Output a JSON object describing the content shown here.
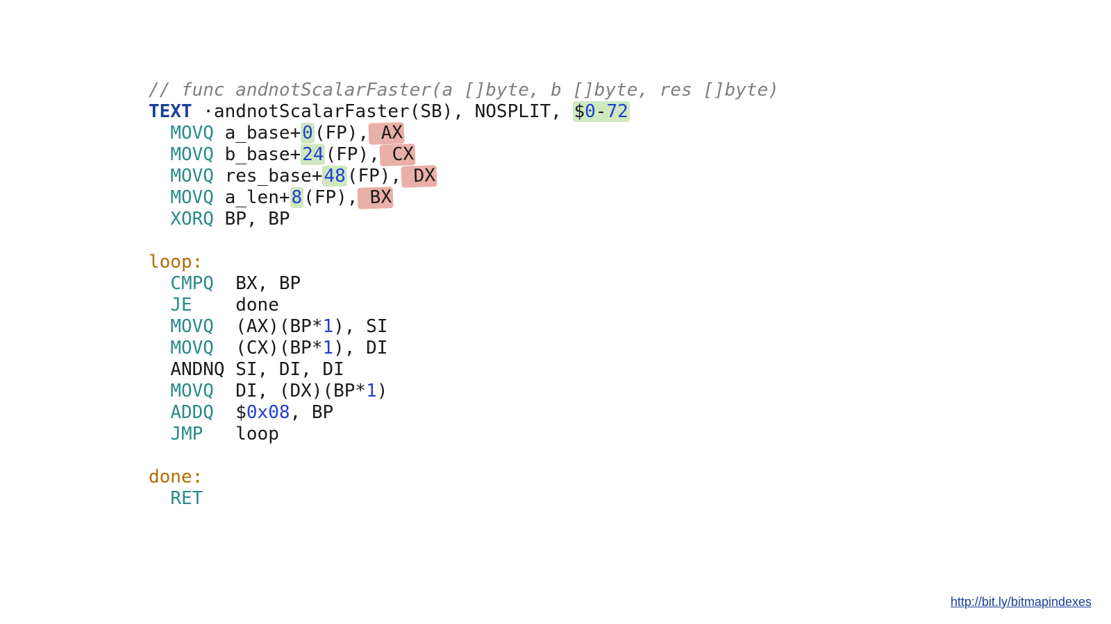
{
  "colors": {
    "comment": "#808080",
    "keyword": "#1a3f9c",
    "mnemonic": "#2b8a8a",
    "number": "#1f3fd6",
    "label": "#b36b00",
    "highlight_green": "#cfe8bf",
    "highlight_red": "#e9b0a7",
    "link": "#1a3f9c"
  },
  "comment_line": "// func andnotScalarFaster(a []byte, b []byte, res []byte)",
  "decl": {
    "kw": "TEXT",
    "name": " ·andnotScalarFaster(SB), NOSPLIT, ",
    "frame_prefix": "$",
    "frame_zero": "0",
    "frame_dash": "-",
    "frame_size": "72"
  },
  "mov1": {
    "op": "MOVQ",
    "arg_pre": " a_base+",
    "off": "0",
    "arg_mid": "(FP),",
    "reg": " AX"
  },
  "mov2": {
    "op": "MOVQ",
    "arg_pre": " b_base+",
    "off": "24",
    "arg_mid": "(FP),",
    "reg": " CX"
  },
  "mov3": {
    "op": "MOVQ",
    "arg_pre": " res_base+",
    "off": "48",
    "arg_mid": "(FP),",
    "reg": " DX"
  },
  "mov4": {
    "op": "MOVQ",
    "arg_pre": " a_len+",
    "off": "8",
    "arg_mid": "(FP),",
    "reg": " BX"
  },
  "xorq": {
    "op": "XORQ",
    "args": " BP, BP"
  },
  "label_loop": "loop:",
  "cmpq": {
    "op": "CMPQ",
    "args": "  BX, BP"
  },
  "je": {
    "op": "JE",
    "args": "    done"
  },
  "l_mov1": {
    "op": "MOVQ",
    "pre": "  (AX)(BP*",
    "one": "1",
    "post": "), SI"
  },
  "l_mov2": {
    "op": "MOVQ",
    "pre": "  (CX)(BP*",
    "one": "1",
    "post": "), DI"
  },
  "andnq": {
    "op": "ANDNQ",
    "args": " SI, DI, DI"
  },
  "l_mov3": {
    "op": "MOVQ",
    "pre": "  DI, (DX)(BP*",
    "one": "1",
    "post": ")"
  },
  "addq": {
    "op": "ADDQ",
    "pre": "  $",
    "hex": "0x08",
    "post": ", BP"
  },
  "jmp": {
    "op": "JMP",
    "args": "   loop"
  },
  "label_done": "done:",
  "ret": {
    "op": "RET"
  },
  "link_text": "http://bit.ly/bitmapindexes"
}
